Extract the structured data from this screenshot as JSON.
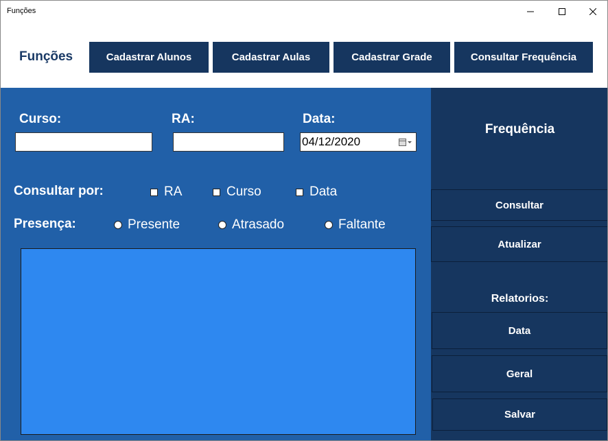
{
  "window": {
    "title": "Funções"
  },
  "header": {
    "brand": "Funções",
    "nav": [
      "Cadastrar Alunos",
      "Cadastrar Aulas",
      "Cadastrar Grade",
      "Consultar Frequência"
    ]
  },
  "form": {
    "curso_label": "Curso:",
    "ra_label": "RA:",
    "data_label": "Data:",
    "curso_value": "",
    "ra_value": "",
    "date_value": "04/12/2020",
    "consultar_por_label": "Consultar por:",
    "checkboxes": [
      "RA",
      "Curso",
      "Data"
    ],
    "presenca_label": "Presença:",
    "radios": [
      "Presente",
      "Atrasado",
      "Faltante"
    ]
  },
  "side": {
    "title": "Frequência",
    "consultar": "Consultar",
    "atualizar": "Atualizar",
    "relatorios_label": "Relatorios:",
    "data": "Data",
    "geral": "Geral",
    "salvar": "Salvar"
  },
  "colors": {
    "dark_blue": "#16365f",
    "panel_blue": "#2160a8",
    "grid_blue": "#2e88f0"
  }
}
